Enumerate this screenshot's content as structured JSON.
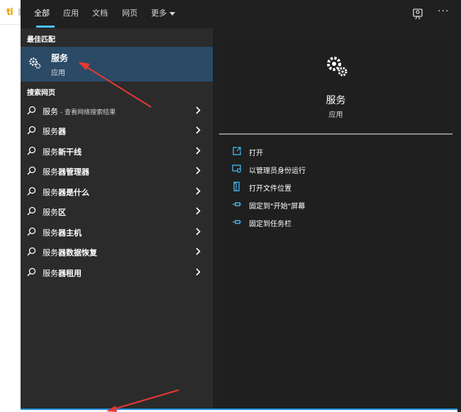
{
  "background": {
    "logo_text": "ti"
  },
  "tabs": [
    {
      "label": "全部",
      "active": true
    },
    {
      "label": "应用",
      "active": false
    },
    {
      "label": "文档",
      "active": false
    },
    {
      "label": "网页",
      "active": false
    },
    {
      "label": "更多",
      "active": false,
      "dropdown": true
    }
  ],
  "toolbar": {
    "feedback_icon": "feedback-icon",
    "more_label": "···"
  },
  "best_match": {
    "heading": "最佳匹配",
    "title": "服务",
    "subtitle": "应用",
    "icon": "gear-icon"
  },
  "web_search": {
    "heading": "搜索网页",
    "items": [
      {
        "prefix": "服务",
        "suffix": "",
        "hint": " - 查看网络搜索结果"
      },
      {
        "prefix": "服务",
        "suffix": "器",
        "hint": ""
      },
      {
        "prefix": "服务",
        "suffix": "新干线",
        "hint": ""
      },
      {
        "prefix": "服务",
        "suffix": "器管理器",
        "hint": ""
      },
      {
        "prefix": "服务",
        "suffix": "器是什么",
        "hint": ""
      },
      {
        "prefix": "服务",
        "suffix": "区",
        "hint": ""
      },
      {
        "prefix": "服务",
        "suffix": "器主机",
        "hint": ""
      },
      {
        "prefix": "服务",
        "suffix": "器数据恢复",
        "hint": ""
      },
      {
        "prefix": "服务",
        "suffix": "器租用",
        "hint": ""
      }
    ]
  },
  "detail": {
    "title": "服务",
    "subtitle": "应用",
    "actions": [
      {
        "label": "打开",
        "icon": "open-icon"
      },
      {
        "label": "以管理员身份运行",
        "icon": "shield-icon"
      },
      {
        "label": "打开文件位置",
        "icon": "folder-icon"
      },
      {
        "label": "固定到\"开始\"屏幕",
        "icon": "pin-icon"
      },
      {
        "label": "固定到任务栏",
        "icon": "pin-icon"
      }
    ]
  },
  "colors": {
    "accent": "#4cc2ff",
    "selected_bg": "#2b4a66",
    "annotation_red": "#e53935"
  }
}
